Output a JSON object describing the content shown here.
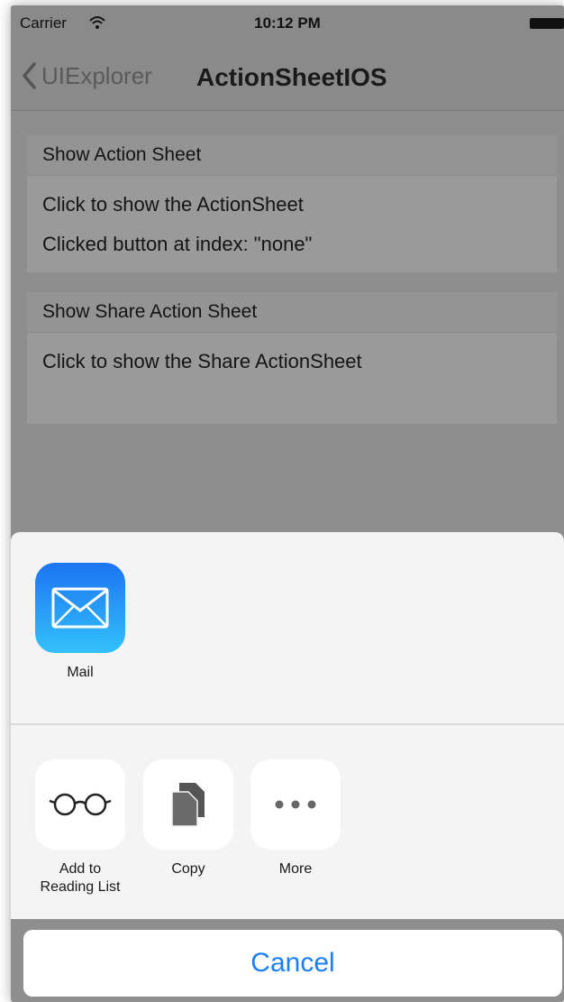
{
  "status_bar": {
    "carrier": "Carrier",
    "time": "10:12 PM"
  },
  "nav": {
    "back_label": "UIExplorer",
    "title": "ActionSheetIOS"
  },
  "sections": [
    {
      "header": "Show Action Sheet",
      "rows": [
        "Click to show the ActionSheet",
        "Clicked button at index: \"none\""
      ]
    },
    {
      "header": "Show Share Action Sheet",
      "rows": [
        "Click to show the Share ActionSheet"
      ]
    }
  ],
  "share_sheet": {
    "apps": [
      {
        "label": "Mail",
        "icon": "mail-icon",
        "color": "#1f8ef6"
      }
    ],
    "actions": [
      {
        "label": "Add to\nReading List",
        "icon": "glasses-icon"
      },
      {
        "label": "Copy",
        "icon": "copy-icon"
      },
      {
        "label": "More",
        "icon": "more-dots-icon"
      }
    ],
    "cancel_label": "Cancel"
  },
  "colors": {
    "accent": "#1a7ef5",
    "dimmed_background": "#8e8e8e",
    "sheet_background": "#f4f4f4"
  }
}
